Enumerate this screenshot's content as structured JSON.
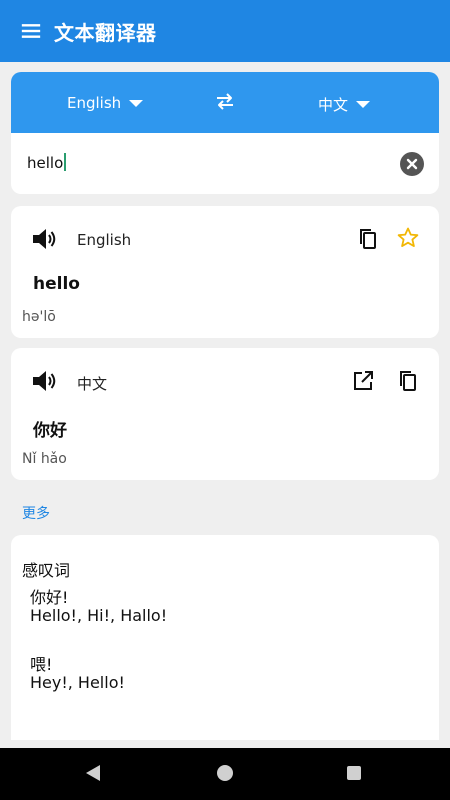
{
  "app": {
    "title": "文本翻译器"
  },
  "languages": {
    "source": "English",
    "target": "中文"
  },
  "input": {
    "value": "hello"
  },
  "source_result": {
    "language": "English",
    "text": "hello",
    "phonetic": "hə'lō"
  },
  "target_result": {
    "language": "中文",
    "text": "你好",
    "phonetic": "Nǐ hǎo"
  },
  "more": {
    "label": "更多"
  },
  "definitions": {
    "part_of_speech": "感叹词",
    "entries": [
      {
        "term": "你好!",
        "synonyms": "Hello!,  Hi!,  Hallo!"
      },
      {
        "term": "喂!",
        "synonyms": "Hey!,  Hello!"
      }
    ]
  },
  "colors": {
    "primary": "#1f86e3",
    "lang_bar": "#2f97ee",
    "favorite": "#f2b705",
    "cursor": "#2a9d6f"
  },
  "icons": [
    "menu-icon",
    "swap-icon",
    "clear-icon",
    "speaker-icon",
    "copy-icon",
    "star-icon",
    "open-external-icon",
    "nav-back-icon",
    "nav-home-icon",
    "nav-recents-icon"
  ]
}
